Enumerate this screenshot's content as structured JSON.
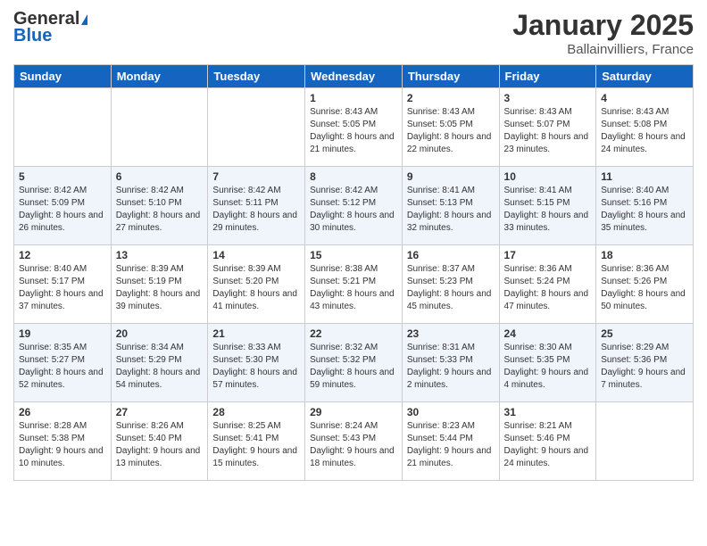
{
  "header": {
    "logo_general": "General",
    "logo_blue": "Blue",
    "month_year": "January 2025",
    "location": "Ballainvilliers, France"
  },
  "weekdays": [
    "Sunday",
    "Monday",
    "Tuesday",
    "Wednesday",
    "Thursday",
    "Friday",
    "Saturday"
  ],
  "weeks": [
    [
      {
        "day": "",
        "info": ""
      },
      {
        "day": "",
        "info": ""
      },
      {
        "day": "",
        "info": ""
      },
      {
        "day": "1",
        "info": "Sunrise: 8:43 AM\nSunset: 5:05 PM\nDaylight: 8 hours and 21 minutes."
      },
      {
        "day": "2",
        "info": "Sunrise: 8:43 AM\nSunset: 5:05 PM\nDaylight: 8 hours and 22 minutes."
      },
      {
        "day": "3",
        "info": "Sunrise: 8:43 AM\nSunset: 5:07 PM\nDaylight: 8 hours and 23 minutes."
      },
      {
        "day": "4",
        "info": "Sunrise: 8:43 AM\nSunset: 5:08 PM\nDaylight: 8 hours and 24 minutes."
      }
    ],
    [
      {
        "day": "5",
        "info": "Sunrise: 8:42 AM\nSunset: 5:09 PM\nDaylight: 8 hours and 26 minutes."
      },
      {
        "day": "6",
        "info": "Sunrise: 8:42 AM\nSunset: 5:10 PM\nDaylight: 8 hours and 27 minutes."
      },
      {
        "day": "7",
        "info": "Sunrise: 8:42 AM\nSunset: 5:11 PM\nDaylight: 8 hours and 29 minutes."
      },
      {
        "day": "8",
        "info": "Sunrise: 8:42 AM\nSunset: 5:12 PM\nDaylight: 8 hours and 30 minutes."
      },
      {
        "day": "9",
        "info": "Sunrise: 8:41 AM\nSunset: 5:13 PM\nDaylight: 8 hours and 32 minutes."
      },
      {
        "day": "10",
        "info": "Sunrise: 8:41 AM\nSunset: 5:15 PM\nDaylight: 8 hours and 33 minutes."
      },
      {
        "day": "11",
        "info": "Sunrise: 8:40 AM\nSunset: 5:16 PM\nDaylight: 8 hours and 35 minutes."
      }
    ],
    [
      {
        "day": "12",
        "info": "Sunrise: 8:40 AM\nSunset: 5:17 PM\nDaylight: 8 hours and 37 minutes."
      },
      {
        "day": "13",
        "info": "Sunrise: 8:39 AM\nSunset: 5:19 PM\nDaylight: 8 hours and 39 minutes."
      },
      {
        "day": "14",
        "info": "Sunrise: 8:39 AM\nSunset: 5:20 PM\nDaylight: 8 hours and 41 minutes."
      },
      {
        "day": "15",
        "info": "Sunrise: 8:38 AM\nSunset: 5:21 PM\nDaylight: 8 hours and 43 minutes."
      },
      {
        "day": "16",
        "info": "Sunrise: 8:37 AM\nSunset: 5:23 PM\nDaylight: 8 hours and 45 minutes."
      },
      {
        "day": "17",
        "info": "Sunrise: 8:36 AM\nSunset: 5:24 PM\nDaylight: 8 hours and 47 minutes."
      },
      {
        "day": "18",
        "info": "Sunrise: 8:36 AM\nSunset: 5:26 PM\nDaylight: 8 hours and 50 minutes."
      }
    ],
    [
      {
        "day": "19",
        "info": "Sunrise: 8:35 AM\nSunset: 5:27 PM\nDaylight: 8 hours and 52 minutes."
      },
      {
        "day": "20",
        "info": "Sunrise: 8:34 AM\nSunset: 5:29 PM\nDaylight: 8 hours and 54 minutes."
      },
      {
        "day": "21",
        "info": "Sunrise: 8:33 AM\nSunset: 5:30 PM\nDaylight: 8 hours and 57 minutes."
      },
      {
        "day": "22",
        "info": "Sunrise: 8:32 AM\nSunset: 5:32 PM\nDaylight: 8 hours and 59 minutes."
      },
      {
        "day": "23",
        "info": "Sunrise: 8:31 AM\nSunset: 5:33 PM\nDaylight: 9 hours and 2 minutes."
      },
      {
        "day": "24",
        "info": "Sunrise: 8:30 AM\nSunset: 5:35 PM\nDaylight: 9 hours and 4 minutes."
      },
      {
        "day": "25",
        "info": "Sunrise: 8:29 AM\nSunset: 5:36 PM\nDaylight: 9 hours and 7 minutes."
      }
    ],
    [
      {
        "day": "26",
        "info": "Sunrise: 8:28 AM\nSunset: 5:38 PM\nDaylight: 9 hours and 10 minutes."
      },
      {
        "day": "27",
        "info": "Sunrise: 8:26 AM\nSunset: 5:40 PM\nDaylight: 9 hours and 13 minutes."
      },
      {
        "day": "28",
        "info": "Sunrise: 8:25 AM\nSunset: 5:41 PM\nDaylight: 9 hours and 15 minutes."
      },
      {
        "day": "29",
        "info": "Sunrise: 8:24 AM\nSunset: 5:43 PM\nDaylight: 9 hours and 18 minutes."
      },
      {
        "day": "30",
        "info": "Sunrise: 8:23 AM\nSunset: 5:44 PM\nDaylight: 9 hours and 21 minutes."
      },
      {
        "day": "31",
        "info": "Sunrise: 8:21 AM\nSunset: 5:46 PM\nDaylight: 9 hours and 24 minutes."
      },
      {
        "day": "",
        "info": ""
      }
    ]
  ]
}
